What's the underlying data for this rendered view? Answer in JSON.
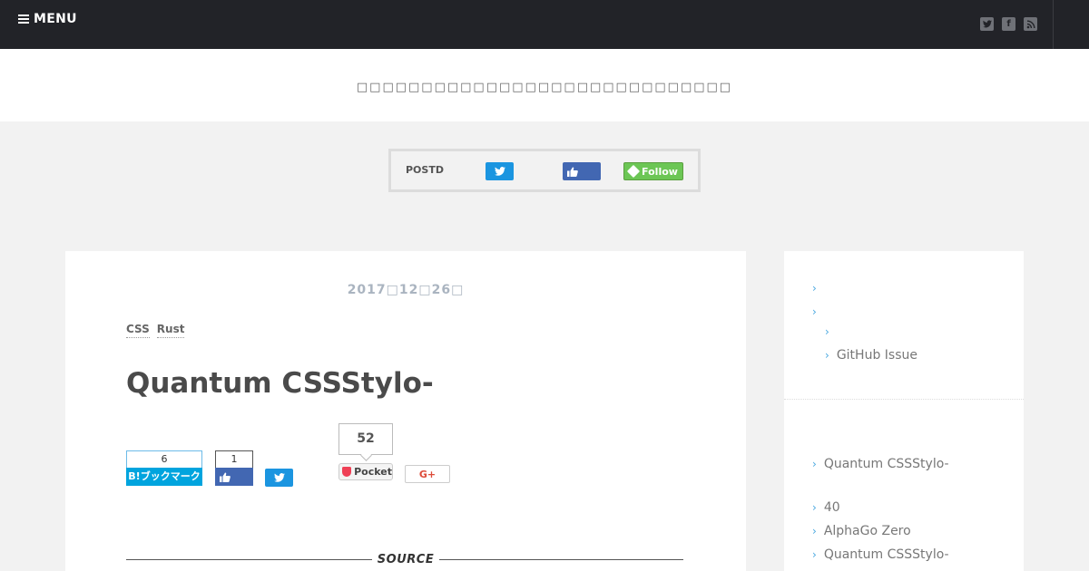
{
  "header": {
    "menu_label": "MENU",
    "social_icons": [
      "twitter-icon",
      "facebook-icon",
      "rss-icon"
    ]
  },
  "tagline": "□□□□□□□□□□□□□□□□□□□□□□□□□□□□□",
  "postd_bar": {
    "label": "POSTD",
    "follow_label": "Follow"
  },
  "article": {
    "date": "2017□12□26□",
    "tags": [
      "CSS",
      "Rust"
    ],
    "title": "Quantum CSSStylo-",
    "share": {
      "hatena_count": "6",
      "hatena_label": "B!ブックマーク",
      "facebook_count": "1",
      "pocket_count": "52",
      "pocket_label": "Pocket",
      "gplus_label": "G+"
    },
    "source_label": "SOURCE"
  },
  "sidebar": {
    "top_items": [
      "GitHub Issue"
    ],
    "bottom_items": [
      "Quantum CSSStylo-",
      "40",
      "AlphaGo Zero",
      "Quantum CSSStylo-"
    ]
  },
  "colors": {
    "topbar": "#222328",
    "twitter": "#1b95e0",
    "facebook": "#4267b2",
    "hatena": "#00a4de",
    "feedly": "#6cc655",
    "pocket": "#ef4056",
    "link_chevron": "#4aa8e0"
  }
}
